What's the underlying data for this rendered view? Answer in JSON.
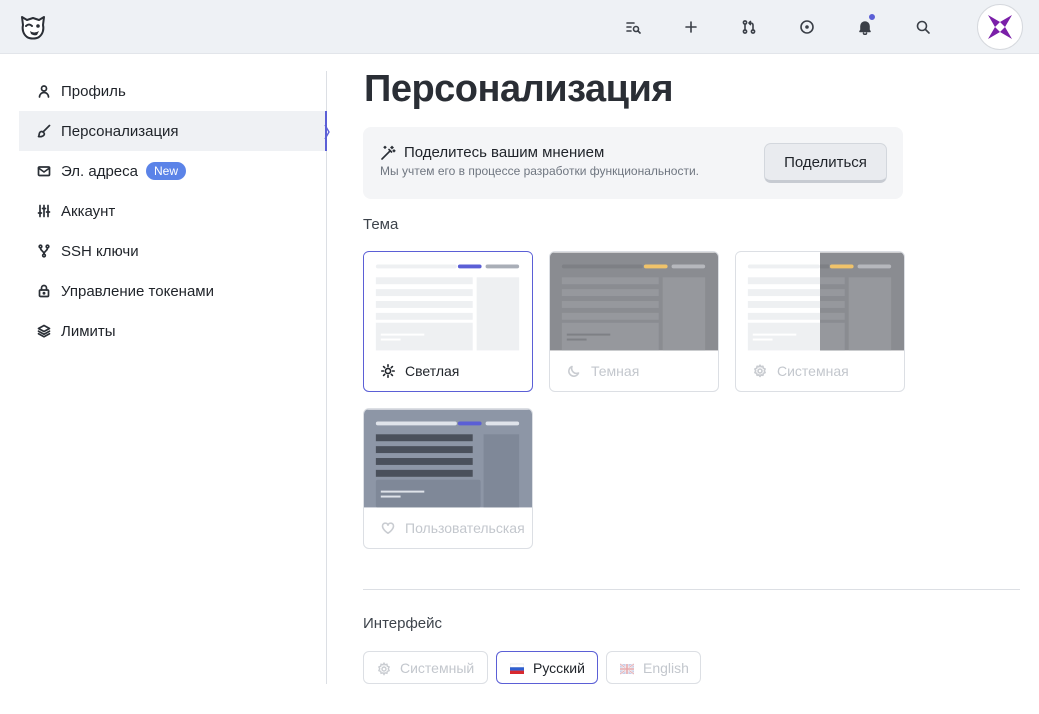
{
  "app": {
    "title": "Персонализация"
  },
  "topbar": {
    "icons": [
      "search-list-icon",
      "plus-icon",
      "merge-request-icon",
      "issue-icon",
      "bell-icon",
      "search-icon"
    ],
    "notification_color": "#5b5fd6"
  },
  "sidebar": {
    "items": [
      {
        "label": "Профиль",
        "icon": "user-icon"
      },
      {
        "label": "Персонализация",
        "icon": "brush-icon",
        "active": true
      },
      {
        "label": "Эл. адреса",
        "icon": "mail-icon",
        "badge": "New"
      },
      {
        "label": "Аккаунт",
        "icon": "sliders-icon"
      },
      {
        "label": "SSH ключи",
        "icon": "branch-icon"
      },
      {
        "label": "Управление токенами",
        "icon": "lock-icon"
      },
      {
        "label": "Лимиты",
        "icon": "layers-icon"
      }
    ]
  },
  "main": {
    "title": "Персонализация",
    "feedback": {
      "title": "Поделитесь вашим мнением",
      "subtitle": "Мы учтем его в процессе разработки функциональности.",
      "button": "Поделиться"
    },
    "theme": {
      "label": "Тема",
      "options": [
        {
          "label": "Светлая",
          "icon": "sun-icon",
          "selected": true
        },
        {
          "label": "Темная",
          "icon": "moon-icon",
          "selected": false
        },
        {
          "label": "Системная",
          "icon": "gear-icon",
          "selected": false
        },
        {
          "label": "Пользовательская",
          "icon": "heart-icon",
          "selected": false
        }
      ]
    },
    "interface": {
      "label": "Интерфейс",
      "options": [
        {
          "label": "Системный",
          "icon": "gear-icon",
          "selected": false
        },
        {
          "label": "Русский",
          "icon": "flag-ru-icon",
          "selected": true
        },
        {
          "label": "English",
          "icon": "flag-uk-icon",
          "selected": false
        }
      ]
    }
  },
  "colors": {
    "accent": "#5b5fd6",
    "badge": "#5b83e8"
  }
}
